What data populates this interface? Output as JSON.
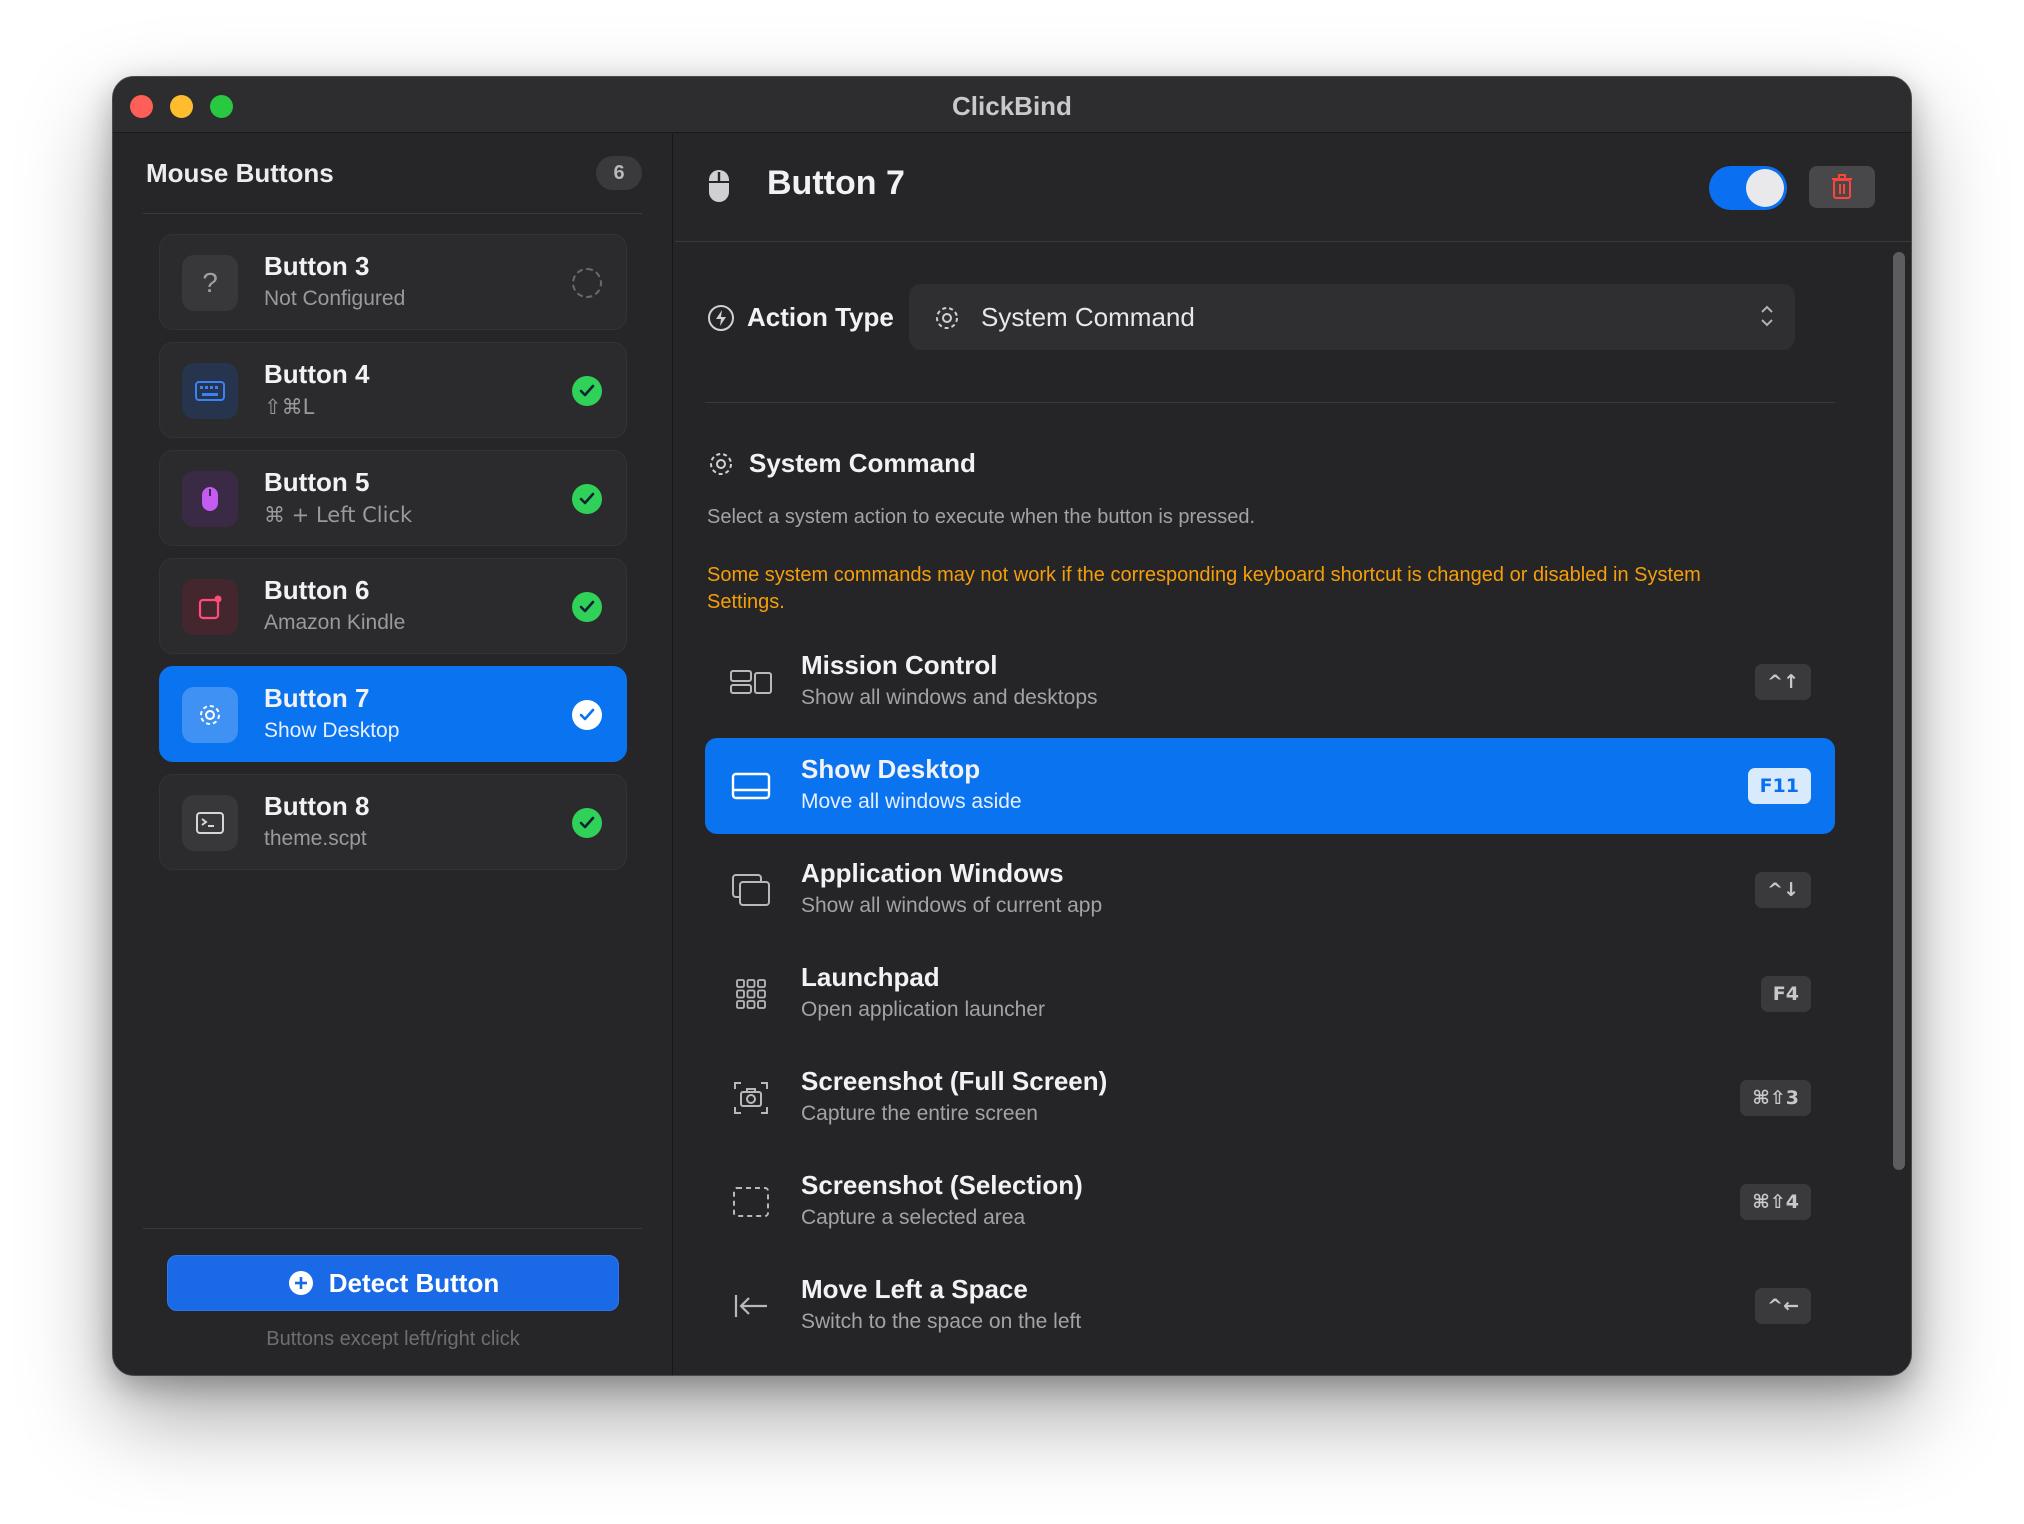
{
  "window": {
    "title": "ClickBind"
  },
  "sidebar": {
    "title": "Mouse Buttons",
    "count": "6",
    "buttons": [
      {
        "name": "Button 3",
        "subtitle": "Not Configured",
        "icon": "question-icon",
        "status": "not-configured"
      },
      {
        "name": "Button 4",
        "subtitle": "⇧⌘L",
        "icon": "keyboard-icon",
        "status": "configured"
      },
      {
        "name": "Button 5",
        "subtitle": "⌘ + Left Click",
        "icon": "mouse-icon",
        "status": "configured"
      },
      {
        "name": "Button 6",
        "subtitle": "Amazon Kindle",
        "icon": "app-icon",
        "status": "configured"
      },
      {
        "name": "Button 7",
        "subtitle": "Show Desktop",
        "icon": "gear-icon",
        "status": "selected"
      },
      {
        "name": "Button 8",
        "subtitle": "theme.scpt",
        "icon": "terminal-icon",
        "status": "configured"
      }
    ],
    "detect_label": "Detect Button",
    "detect_hint": "Buttons except left/right click"
  },
  "main": {
    "title": "Button 7",
    "enabled": true,
    "action_type_label": "Action Type",
    "action_type_value": "System Command",
    "section_title": "System Command",
    "section_desc": "Select a system action to execute when the button is pressed.",
    "warning": "Some system commands may not work if the corresponding keyboard shortcut is changed or disabled in System Settings.",
    "commands": [
      {
        "name": "Mission Control",
        "desc": "Show all windows and desktops",
        "shortcut": "^↑",
        "icon": "mission-control-icon",
        "selected": false
      },
      {
        "name": "Show Desktop",
        "desc": "Move all windows aside",
        "shortcut": "F11",
        "icon": "desktop-icon",
        "selected": true
      },
      {
        "name": "Application Windows",
        "desc": "Show all windows of current app",
        "shortcut": "^↓",
        "icon": "app-windows-icon",
        "selected": false
      },
      {
        "name": "Launchpad",
        "desc": "Open application launcher",
        "shortcut": "F4",
        "icon": "grid-icon",
        "selected": false
      },
      {
        "name": "Screenshot (Full Screen)",
        "desc": "Capture the entire screen",
        "shortcut": "⌘⇧3",
        "icon": "camera-icon",
        "selected": false
      },
      {
        "name": "Screenshot (Selection)",
        "desc": "Capture a selected area",
        "shortcut": "⌘⇧4",
        "icon": "selection-icon",
        "selected": false
      },
      {
        "name": "Move Left a Space",
        "desc": "Switch to the space on the left",
        "shortcut": "^←",
        "icon": "arrow-left-icon",
        "selected": false
      }
    ]
  },
  "colors": {
    "accent": "#0a73f0",
    "success": "#30d158",
    "warning": "#f59e0b",
    "danger": "#ff453a"
  }
}
